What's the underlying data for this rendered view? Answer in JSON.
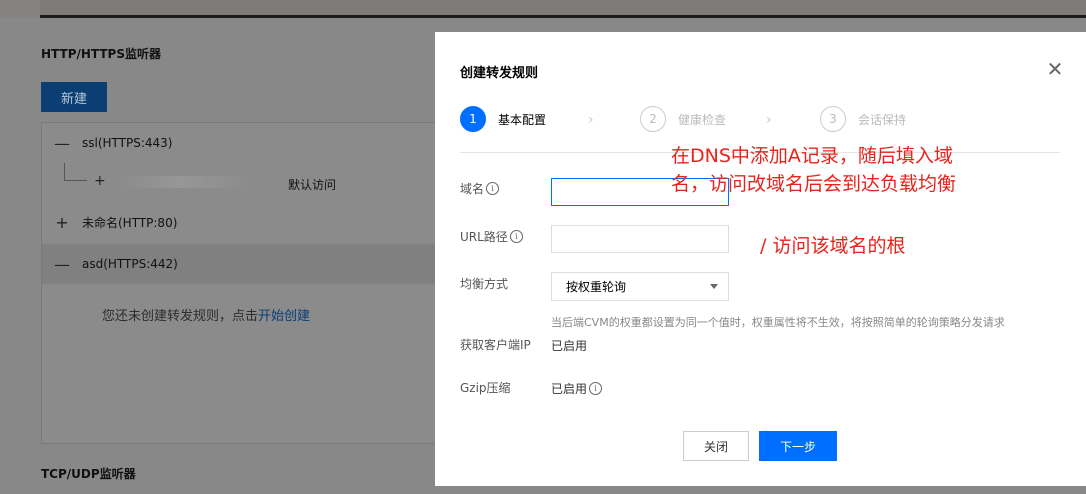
{
  "background": {
    "http_section_title": "HTTP/HTTPS监听器",
    "new_button": "新建",
    "listeners": [
      {
        "sign": "—",
        "label": "ssl(HTTPS:443)"
      },
      {
        "sign": "+",
        "label": "未命名(HTTP:80)"
      },
      {
        "sign": "—",
        "label": "asd(HTTPS:442)"
      }
    ],
    "sub_rule": {
      "sign": "+",
      "default_label": "默认访问"
    },
    "empty_hint": "您还未创建转发规则，点击",
    "empty_hint_link": "开始创建",
    "tcp_section_title": "TCP/UDP监听器"
  },
  "modal": {
    "title": "创建转发规则",
    "close_icon": "close-icon",
    "steps": [
      {
        "num": "1",
        "label": "基本配置",
        "active": true
      },
      {
        "num": "2",
        "label": "健康检查",
        "active": false
      },
      {
        "num": "3",
        "label": "会话保持",
        "active": false
      }
    ],
    "step_arrow": "›",
    "fields": {
      "domain_label": "域名",
      "domain_value": "",
      "url_label": "URL路径",
      "url_value": "",
      "balance_label": "均衡方式",
      "balance_value": "按权重轮询",
      "balance_hint": "当后端CVM的权重都设置为同一个值时，权重属性将不生效，将按照简单的轮询策略分发请求",
      "client_ip_label": "获取客户端IP",
      "client_ip_value": "已启用",
      "gzip_label": "Gzip压缩",
      "gzip_value": "已启用"
    },
    "buttons": {
      "cancel": "关闭",
      "next": "下一步"
    },
    "accent_color": "#006eff"
  },
  "annotations": {
    "note1_line1": "在DNS中添加A记录，随后填入域",
    "note1_line2": "名，访问改域名后会到达负载均衡",
    "note2": "/ 访问该域名的根",
    "color": "#e8231b"
  }
}
